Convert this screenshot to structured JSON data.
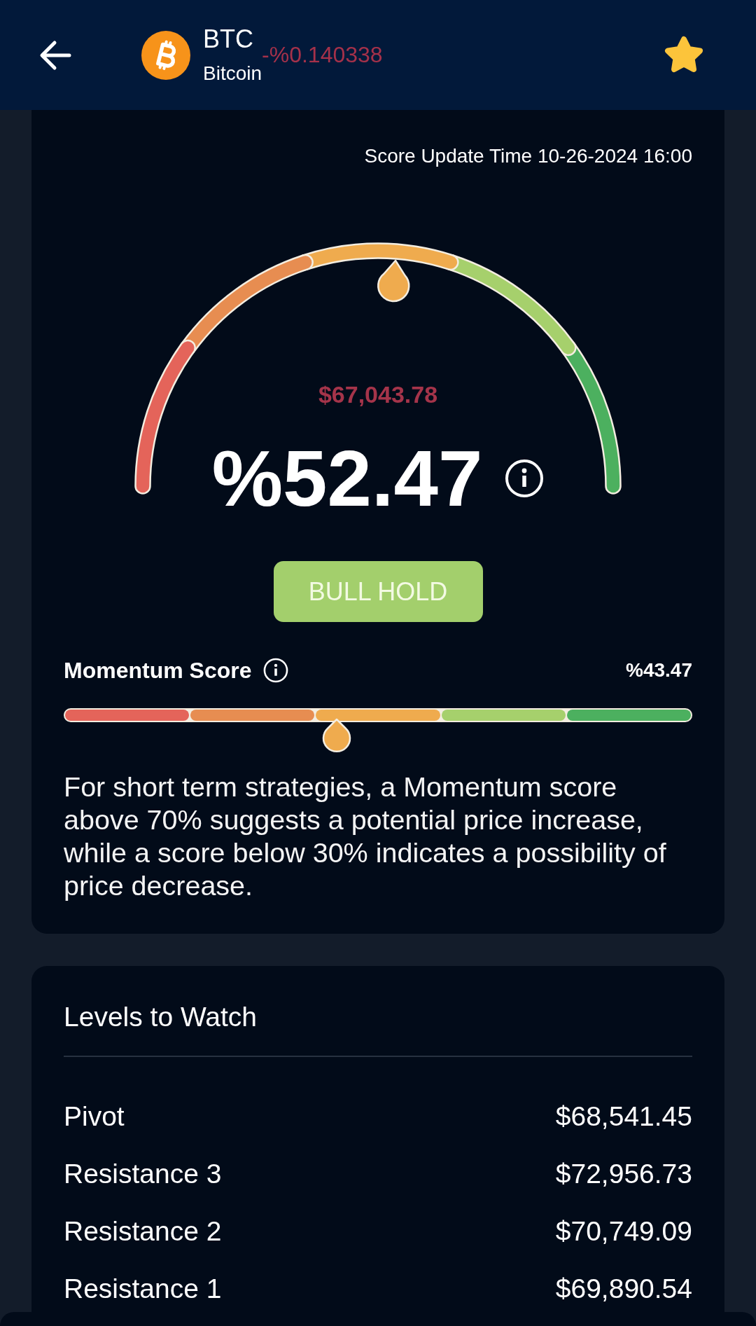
{
  "header": {
    "symbol": "BTC",
    "name": "Bitcoin",
    "change": "-%0.140338",
    "favorite": true
  },
  "score_card": {
    "update_time": "Score Update Time 10-26-2024 16:00",
    "gauge": {
      "price": "$67,043.78",
      "score": "%52.47",
      "level": 0.5247
    },
    "signal": "BULL HOLD",
    "momentum": {
      "label": "Momentum Score",
      "value": "%43.47",
      "level": 0.4347
    },
    "description": "For short term strategies, a Momentum score above 70% suggests a potential price increase, while a score below 30% indicates a possibility of price decrease."
  },
  "levels": {
    "title": "Levels to Watch",
    "rows": [
      {
        "label": "Pivot",
        "value": "$68,541.45"
      },
      {
        "label": "Resistance 3",
        "value": "$72,956.73"
      },
      {
        "label": "Resistance 2",
        "value": "$70,749.09"
      },
      {
        "label": "Resistance 1",
        "value": "$69,890.54"
      }
    ]
  }
}
